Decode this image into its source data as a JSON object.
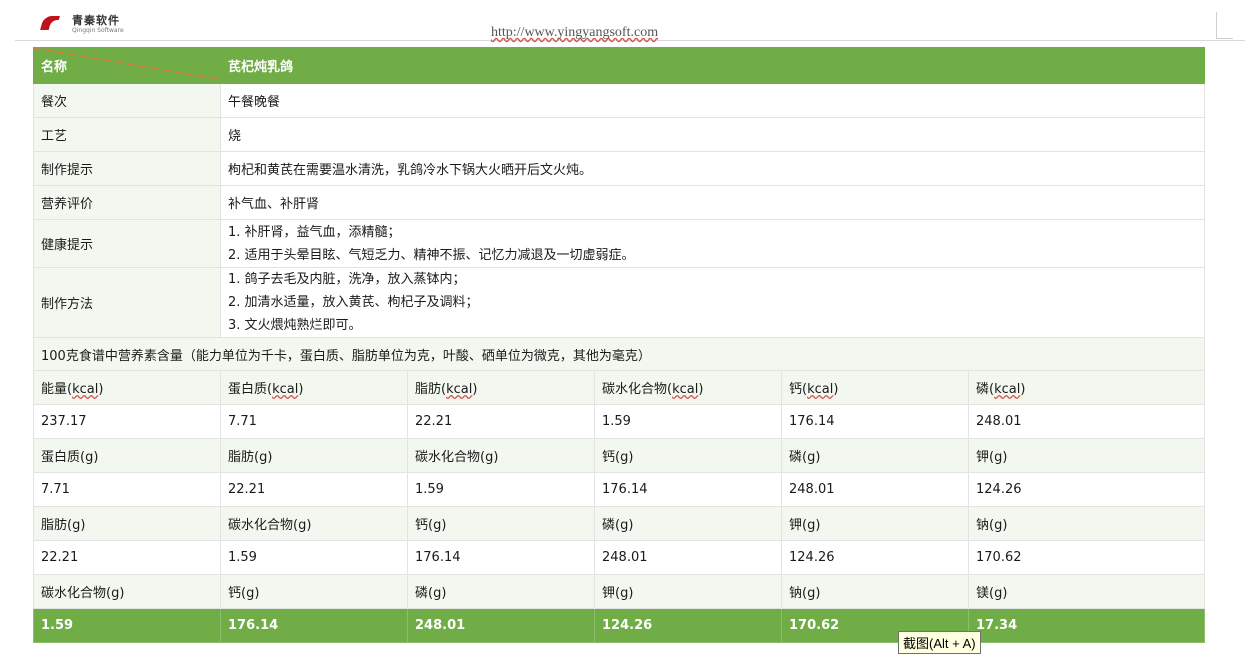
{
  "header": {
    "logo_cn": "青秦软件",
    "logo_en": "Qingqin Software",
    "url": "http://www.yingyangsoft.com"
  },
  "recipe": {
    "name_label": "名称",
    "name_value": "芪杞炖乳鸽",
    "rows": [
      {
        "label": "餐次",
        "lines": [
          "午餐晚餐"
        ]
      },
      {
        "label": "工艺",
        "lines": [
          "烧"
        ]
      },
      {
        "label": "制作提示",
        "lines": [
          "枸杞和黄芪在需要温水清洗，乳鸽冷水下锅大火晒开后文火炖。"
        ]
      },
      {
        "label": "营养评价",
        "lines": [
          "补气血、补肝肾"
        ]
      },
      {
        "label": "健康提示",
        "lines": [
          "1. 补肝肾，益气血，添精髓；",
          "2. 适用于头晕目眩、气短乏力、精神不振、记忆力减退及一切虚弱症。"
        ]
      },
      {
        "label": "制作方法",
        "lines": [
          "1. 鸽子去毛及内脏，洗净，放入蒸钵内；",
          "2. 加清水适量，放入黄芪、枸杞子及调料；",
          "3. 文火煨炖熟烂即可。"
        ]
      }
    ]
  },
  "nutrition": {
    "note": "100克食谱中营养素含量（能力单位为千卡，蛋白质、脂肪单位为克，叶酸、硒单位为微克，其他为毫克）",
    "groups": [
      {
        "headers": [
          "能量(kcal)",
          "蛋白质(kcal)",
          "脂肪(kcal)",
          "碳水化合物(kcal)",
          "钙(kcal)",
          "磷(kcal)"
        ],
        "values": [
          "237.17",
          "7.71",
          "22.21",
          "1.59",
          "176.14",
          "248.01"
        ]
      },
      {
        "headers": [
          "蛋白质(g)",
          "脂肪(g)",
          "碳水化合物(g)",
          "钙(g)",
          "磷(g)",
          "钾(g)"
        ],
        "values": [
          "7.71",
          "22.21",
          "1.59",
          "176.14",
          "248.01",
          "124.26"
        ]
      },
      {
        "headers": [
          "脂肪(g)",
          "碳水化合物(g)",
          "钙(g)",
          "磷(g)",
          "钾(g)",
          "钠(g)"
        ],
        "values": [
          "22.21",
          "1.59",
          "176.14",
          "248.01",
          "124.26",
          "170.62"
        ]
      },
      {
        "headers": [
          "碳水化合物(g)",
          "钙(g)",
          "磷(g)",
          "钾(g)",
          "钠(g)",
          "镁(g)"
        ],
        "values": [
          "1.59",
          "176.14",
          "248.01",
          "124.26",
          "170.62",
          "17.34"
        ]
      }
    ]
  },
  "tooltip": "截图(Alt + A)",
  "colors": {
    "accent_green": "#71ad47",
    "label_bg": "#f2f8ef"
  }
}
